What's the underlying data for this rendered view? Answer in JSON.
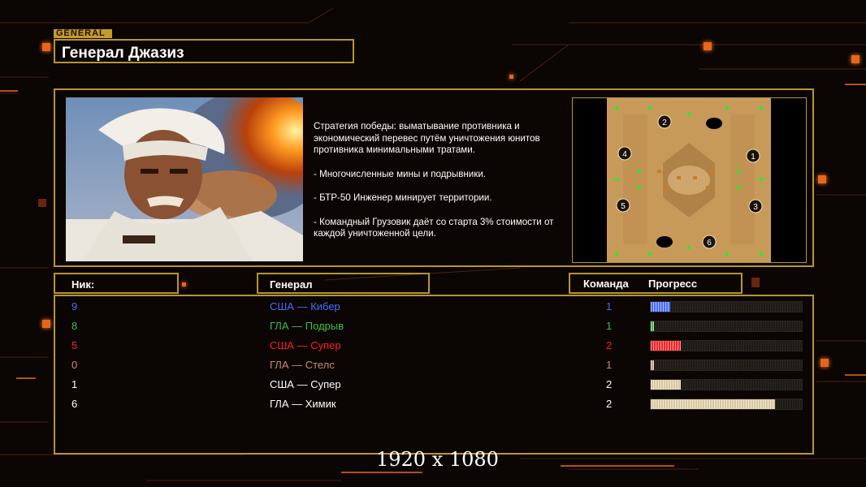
{
  "header": {
    "tag": "GENERAL",
    "title": "Генерал Джазиз"
  },
  "description": [
    "Стратегия победы: выматывание противника и экономический перевес путём уничтожения юнитов противника минимальными тратами.",
    "- Многочисленные мины и подрывники.",
    "- БТР-50 Инженер минирует территории.",
    "- Командный Грузовик даёт со старта 3% стоимости от каждой уничтоженной цели."
  ],
  "minimap": {
    "spawns": [
      "1",
      "2",
      "3",
      "4",
      "5",
      "6"
    ]
  },
  "columns": {
    "nick": "Ник:",
    "general": "Генерал",
    "team": "Команда",
    "progress": "Прогресс"
  },
  "players": [
    {
      "nick": "9",
      "general": "США — Кибер",
      "team": "1",
      "color": "#4a6cff",
      "progress": 0.13
    },
    {
      "nick": "8",
      "general": "ГЛА — Подрыв",
      "team": "1",
      "color": "#3fc03f",
      "progress": 0.02
    },
    {
      "nick": "5",
      "general": "США — Супер",
      "team": "2",
      "color": "#ff2020",
      "progress": 0.2
    },
    {
      "nick": "0",
      "general": "ГЛА — Стелс",
      "team": "1",
      "color": "#c89060",
      "progress": 0.02
    },
    {
      "nick": "1",
      "general": "США — Супер",
      "team": "2",
      "color": "#ffffff",
      "progress": 0.2
    },
    {
      "nick": "6",
      "general": "ГЛА — Химик",
      "team": "2",
      "color": "#ffffff",
      "progress": 0.83
    }
  ],
  "footer": {
    "resolution": "1920 x 1080"
  },
  "colors": {
    "accent_gold": "#b8962a",
    "orange": "#e8661a",
    "background": "#0b0503"
  }
}
